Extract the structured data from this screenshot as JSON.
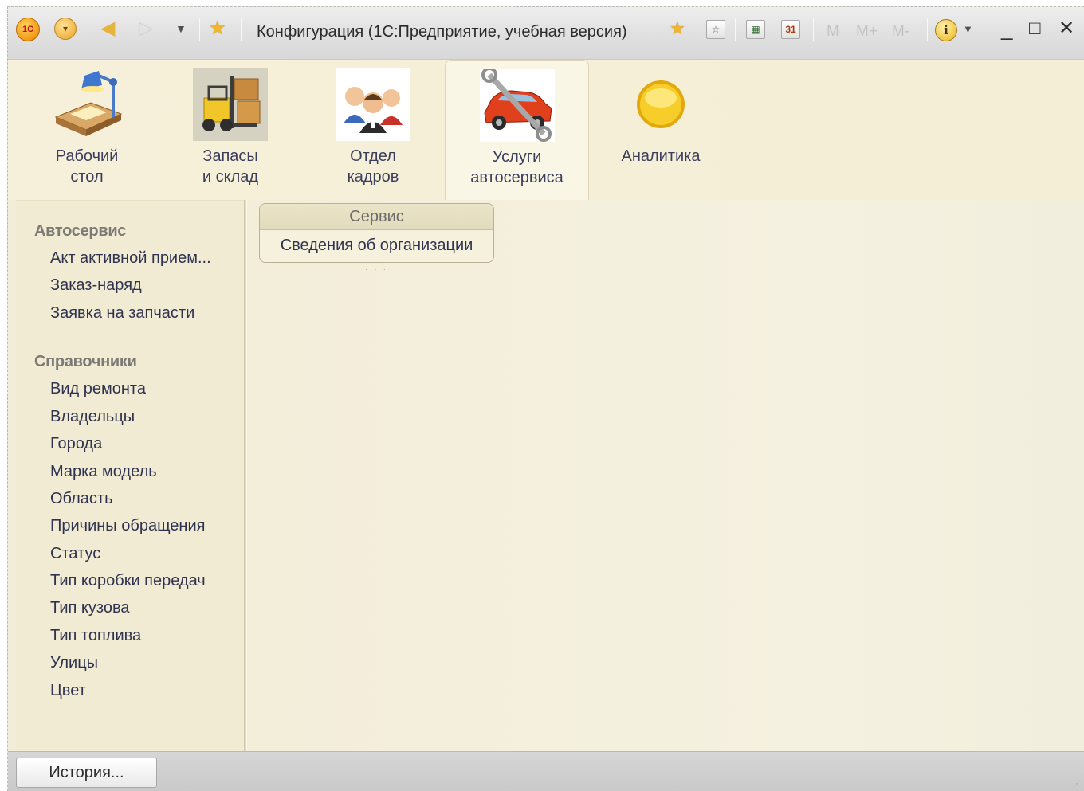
{
  "window": {
    "title": "Конфигурация  (1С:Предприятие, учебная версия)",
    "logo_text": "1С"
  },
  "toolbar": {
    "memory_buttons": [
      "M",
      "M+",
      "M-"
    ],
    "calendar_day": "31",
    "minimize": "_",
    "maximize": "□",
    "close": "✕"
  },
  "sections": [
    {
      "label": "Рабочий\nстол",
      "icon": "desk-lamp-icon"
    },
    {
      "label": "Запасы\nи склад",
      "icon": "forklift-icon"
    },
    {
      "label": "Отдел\nкадров",
      "icon": "people-icon"
    },
    {
      "label": "Услуги\nавтосервиса",
      "icon": "car-wrench-icon",
      "active": true
    },
    {
      "label": "Аналитика",
      "icon": "yellow-circle-icon"
    }
  ],
  "navigation": {
    "groups": [
      {
        "title": "Автосервис",
        "items": [
          "Акт активной прием...",
          "Заказ-наряд",
          "Заявка на запчасти"
        ]
      },
      {
        "title": "Справочники",
        "items": [
          "Вид ремонта",
          "Владельцы",
          "Города",
          "Марка модель",
          "Область",
          "Причины обращения",
          "Статус",
          "Тип коробки передач",
          "Тип кузова",
          "Тип топлива",
          "Улицы",
          "Цвет"
        ]
      }
    ]
  },
  "actions": {
    "group_title": "Сервис",
    "items": [
      "Сведения об организации"
    ]
  },
  "bottom": {
    "history_label": "История..."
  },
  "colors": {
    "background": "#f2ecd8",
    "text_link": "#2f3350",
    "group_title": "#7b7a74",
    "accent": "#f0b531"
  }
}
